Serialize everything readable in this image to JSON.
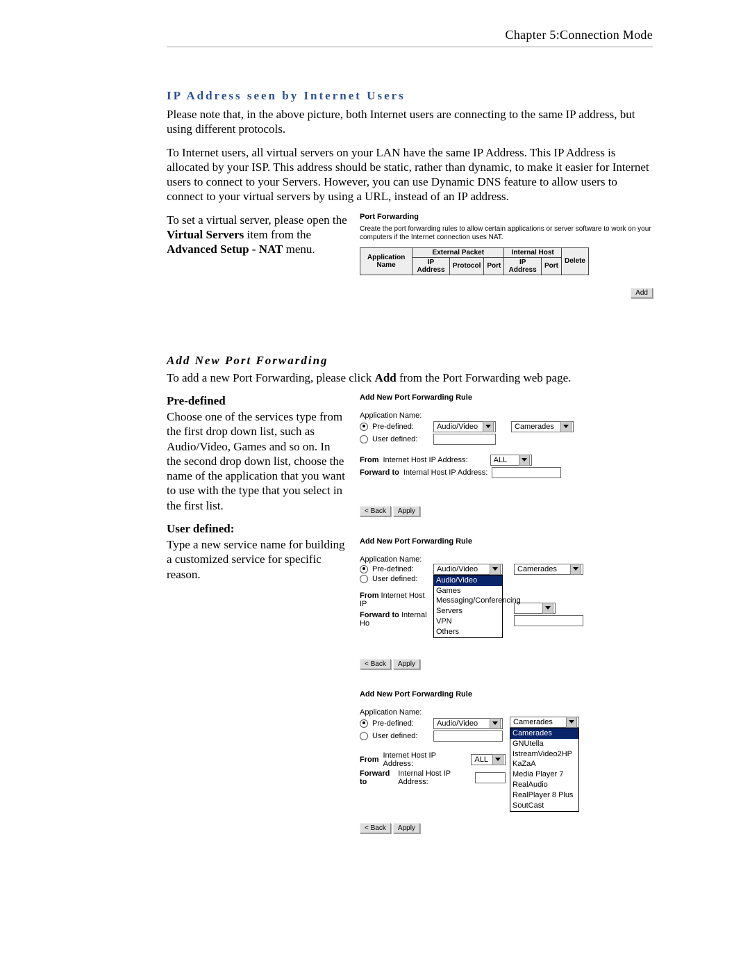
{
  "chapter": "Chapter 5:Connection Mode",
  "section1": {
    "title": "IP Address seen by Internet Users",
    "p1": "Please note that, in the above picture, both Internet users are connecting to the same IP address, but using different protocols.",
    "p2": "To Internet users, all virtual servers on your LAN have the same IP Address. This IP Address is allocated by your ISP. This address should be static, rather than dynamic, to make it easier for Internet users to connect to your Servers. However, you can use Dynamic DNS feature to allow users to connect to your virtual servers by using a URL, instead of an IP address.",
    "p3a": "To set a virtual server, please open the ",
    "p3b": "Virtual Servers",
    "p3c": " item from the ",
    "p3d": "Advanced Setup - NAT",
    "p3e": " menu."
  },
  "pfshot": {
    "heading": "Port Forwarding",
    "desc": "Create the port forwarding rules to allow certain applications or server software to work on your computers if the Internet connection uses NAT.",
    "th_app": "Application Name",
    "th_ext": "External Packet",
    "th_int": "Internal Host",
    "th_delete": "Delete",
    "th_ip": "IP Address",
    "th_proto": "Protocol",
    "th_port": "Port",
    "add_btn": "Add"
  },
  "section2": {
    "title": "Add New Port Forwarding",
    "p1a": "To add a new Port Forwarding, please click ",
    "p1b": "Add",
    "p1c": " from the Port Forwarding web page.",
    "predef_h": "Pre-defined",
    "predef_p": "Choose one of the services type from the first drop down list, such as Audio/Video, Games and so on. In the second drop down list, choose the name of the application that you want to use with the type that you select in the first list.",
    "userdef_h": "User defined:",
    "userdef_p": "Type a new service name for building a customized service for specific reason."
  },
  "rule": {
    "heading": "Add New Port Forwarding Rule",
    "app_label": "Application Name:",
    "predef_label": "Pre-defined:",
    "userdef_label": "User defined:",
    "from_label1": "From",
    "from_label2": " Internet Host IP Address:",
    "fwd_label1": "Forward to",
    "fwd_label2": " Internal Host IP Address:",
    "from_short": " Internet Host IP",
    "fwd_short": " Internal Ho",
    "sel_type": "Audio/Video",
    "sel_app": "Camerades",
    "sel_all": "ALL",
    "back_btn": "< Back",
    "apply_btn": "Apply",
    "type_opts": [
      "Audio/Video",
      "Games",
      "Messaging/Conferencing",
      "Servers",
      "VPN",
      "Others"
    ],
    "app_opts": [
      "Camerades",
      "GNUtella",
      "IstreamVideo2HP",
      "KaZaA",
      "Media Player 7",
      "RealAudio",
      "RealPlayer 8 Plus",
      "SoutCast"
    ]
  }
}
